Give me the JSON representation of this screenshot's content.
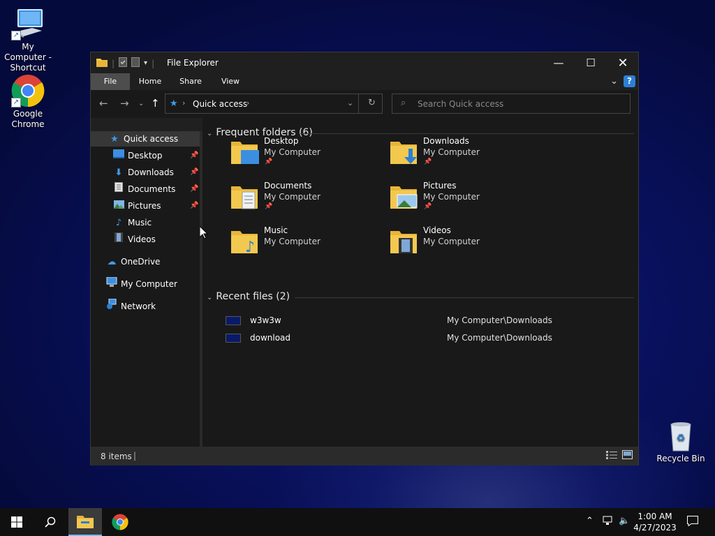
{
  "desktop": {
    "icons": [
      {
        "label": "My Computer - Shortcut"
      },
      {
        "label": "Google Chrome"
      },
      {
        "label": "Recycle Bin"
      }
    ]
  },
  "window": {
    "title": "File Explorer",
    "ribbon_tabs": [
      "File",
      "Home",
      "Share",
      "View"
    ],
    "address": {
      "location": "Quick access"
    },
    "search": {
      "placeholder": "Search Quick access"
    },
    "sidebar": {
      "quick_access": "Quick access",
      "items": [
        {
          "label": "Desktop",
          "pinned": true,
          "icon": "desktop-icon"
        },
        {
          "label": "Downloads",
          "pinned": true,
          "icon": "downloads-icon"
        },
        {
          "label": "Documents",
          "pinned": true,
          "icon": "documents-icon"
        },
        {
          "label": "Pictures",
          "pinned": true,
          "icon": "pictures-icon"
        },
        {
          "label": "Music",
          "pinned": false,
          "icon": "music-icon"
        },
        {
          "label": "Videos",
          "pinned": false,
          "icon": "videos-icon"
        }
      ],
      "onedrive": "OneDrive",
      "my_computer": "My Computer",
      "network": "Network"
    },
    "frequent": {
      "header": "Frequent folders (6)",
      "folders": [
        {
          "name": "Desktop",
          "location": "My Computer",
          "pinned": true
        },
        {
          "name": "Downloads",
          "location": "My Computer",
          "pinned": true
        },
        {
          "name": "Documents",
          "location": "My Computer",
          "pinned": true
        },
        {
          "name": "Pictures",
          "location": "My Computer",
          "pinned": true
        },
        {
          "name": "Music",
          "location": "My Computer",
          "pinned": false
        },
        {
          "name": "Videos",
          "location": "My Computer",
          "pinned": false
        }
      ]
    },
    "recent": {
      "header": "Recent files (2)",
      "files": [
        {
          "name": "w3w3w",
          "path": "My Computer\\Downloads"
        },
        {
          "name": "download",
          "path": "My Computer\\Downloads"
        }
      ]
    },
    "status": {
      "items": "8 items"
    }
  },
  "taskbar": {
    "time": "1:00 AM",
    "date": "4/27/2023"
  },
  "colors": {
    "accent": "#2b80d6",
    "window_bg": "#191919",
    "folder_yellow": "#f3c84f"
  }
}
